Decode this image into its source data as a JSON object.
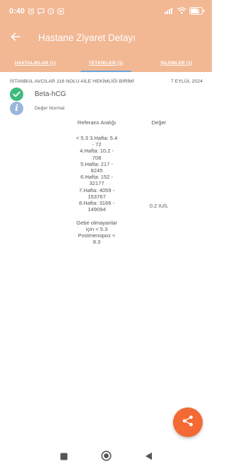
{
  "status_bar": {
    "time": "0:40",
    "battery": "77",
    "icons": [
      "alarm-icon",
      "message-icon",
      "clock-icon",
      "whatsapp-icon",
      "signal-icon",
      "wifi-icon",
      "battery-icon"
    ]
  },
  "app_bar": {
    "title": "Hastane Ziyaret Detayı",
    "back_icon": "arrow-left-icon"
  },
  "tabs": [
    {
      "label": "HASTALIKLAR (1)",
      "active": false
    },
    {
      "label": "TETKİKLER (1)",
      "active": true
    },
    {
      "label": "İŞLEMLER (1)",
      "active": false
    }
  ],
  "visit": {
    "facility": "İSTANBUL AVCILAR 116 NOLU AİLE HEKİMLİĞİ BİRİMİ",
    "date": "7 EYLÜL 2024"
  },
  "test": {
    "name": "Beta-hCG",
    "status_icon": "check-circle-icon",
    "info_icon": "info-icon",
    "status_text": "Değer Normal"
  },
  "table": {
    "ref_header": "Referans Aralığı",
    "value_header": "Değer",
    "reference": "< 5.3  3.Hafta: 5.4\n- 72\n4.Hafta: 10.2 -\n708\n5.Hafta: 217 -\n8245\n6.Hafta: 152 -\n32177\n7.Hafta: 4059 -\n153767\n8.Hafta: 3166 -\n149094\n\nGebe olmayanlar\niçin < 5.3\nPostmenopoz  <\n8.3",
    "value": "0.2 IU/L"
  },
  "fab": {
    "icon": "share-icon"
  },
  "colors": {
    "header": "#f2b793",
    "tab_indicator": "#6aa7d8",
    "check_green": "#3dba7a",
    "info_blue": "#9bb6db",
    "fab_orange": "#f36a34"
  },
  "nav_bar": {
    "icons": [
      "recents-square-icon",
      "home-circle-icon",
      "back-triangle-icon"
    ]
  }
}
